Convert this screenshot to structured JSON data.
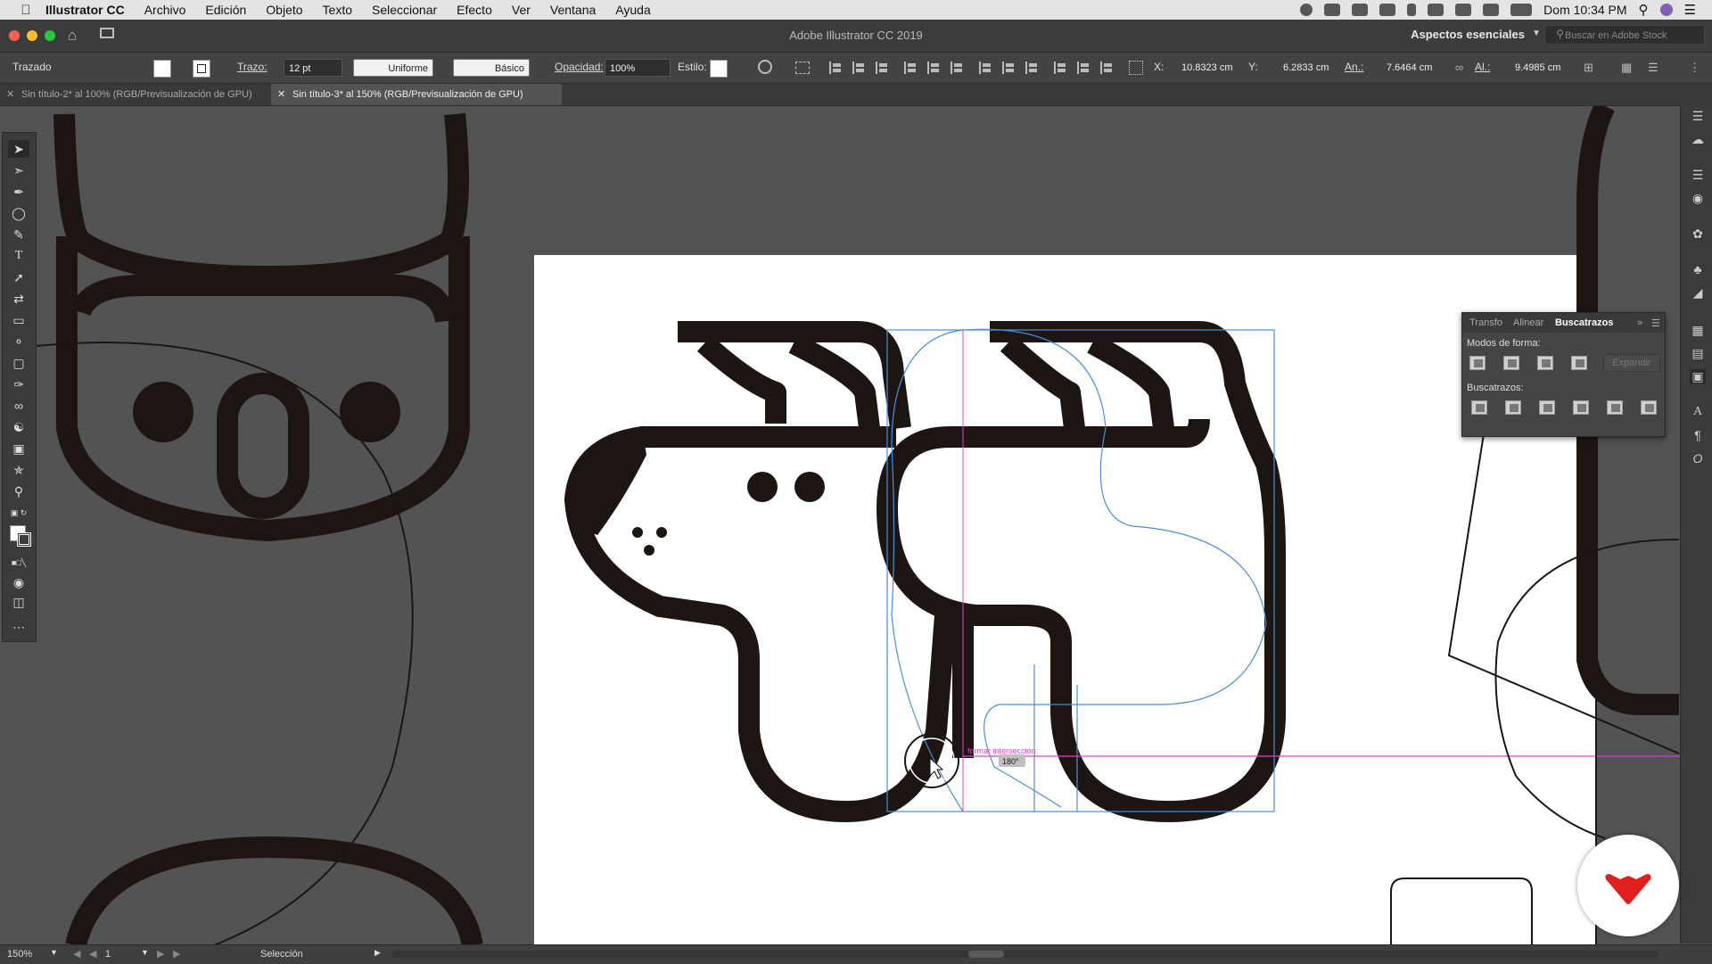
{
  "menubar": {
    "app_name": "Illustrator CC",
    "items": [
      "Archivo",
      "Edición",
      "Objeto",
      "Texto",
      "Seleccionar",
      "Efecto",
      "Ver",
      "Ventana",
      "Ayuda"
    ],
    "clock": "Dom 10:34 PM"
  },
  "window": {
    "title": "Adobe Illustrator CC 2019",
    "workspace": "Aspectos esenciales",
    "stock_placeholder": "Buscar en Adobe Stock"
  },
  "control": {
    "selection_type": "Trazado",
    "stroke_label": "Trazo:",
    "stroke_weight": "12 pt",
    "profile": "Uniforme",
    "brush": "Básico",
    "opacity_label": "Opacidad:",
    "opacity": "100%",
    "style_label": "Estilo:",
    "x_label": "X:",
    "x": "10.8323 cm",
    "y_label": "Y:",
    "y": "6.2833 cm",
    "w_label": "An.:",
    "w": "7.6464 cm",
    "h_label": "Al.:",
    "h": "9.4985 cm"
  },
  "tabs": [
    {
      "label": "Sin título-2* al 100% (RGB/Previsualización de GPU)",
      "active": false
    },
    {
      "label": "Sin título-3* al 150% (RGB/Previsualización de GPU)",
      "active": true
    }
  ],
  "pathfinder": {
    "tabs": [
      "Transfo",
      "Alinear",
      "Buscatrazos"
    ],
    "shape_modes_label": "Modos de forma:",
    "expand_label": "Expandir",
    "pathfinders_label": "Buscatrazos:"
  },
  "canvas": {
    "smart_guide_label": "formar intersección",
    "angle_label": "180°"
  },
  "status": {
    "zoom": "150%",
    "artboard": "1",
    "tool": "Selección"
  },
  "colors": {
    "artwork": "#1d1512",
    "guide_magenta": "#e040d0",
    "selection_blue": "#4a8fd8",
    "badge_red": "#e0201c"
  }
}
